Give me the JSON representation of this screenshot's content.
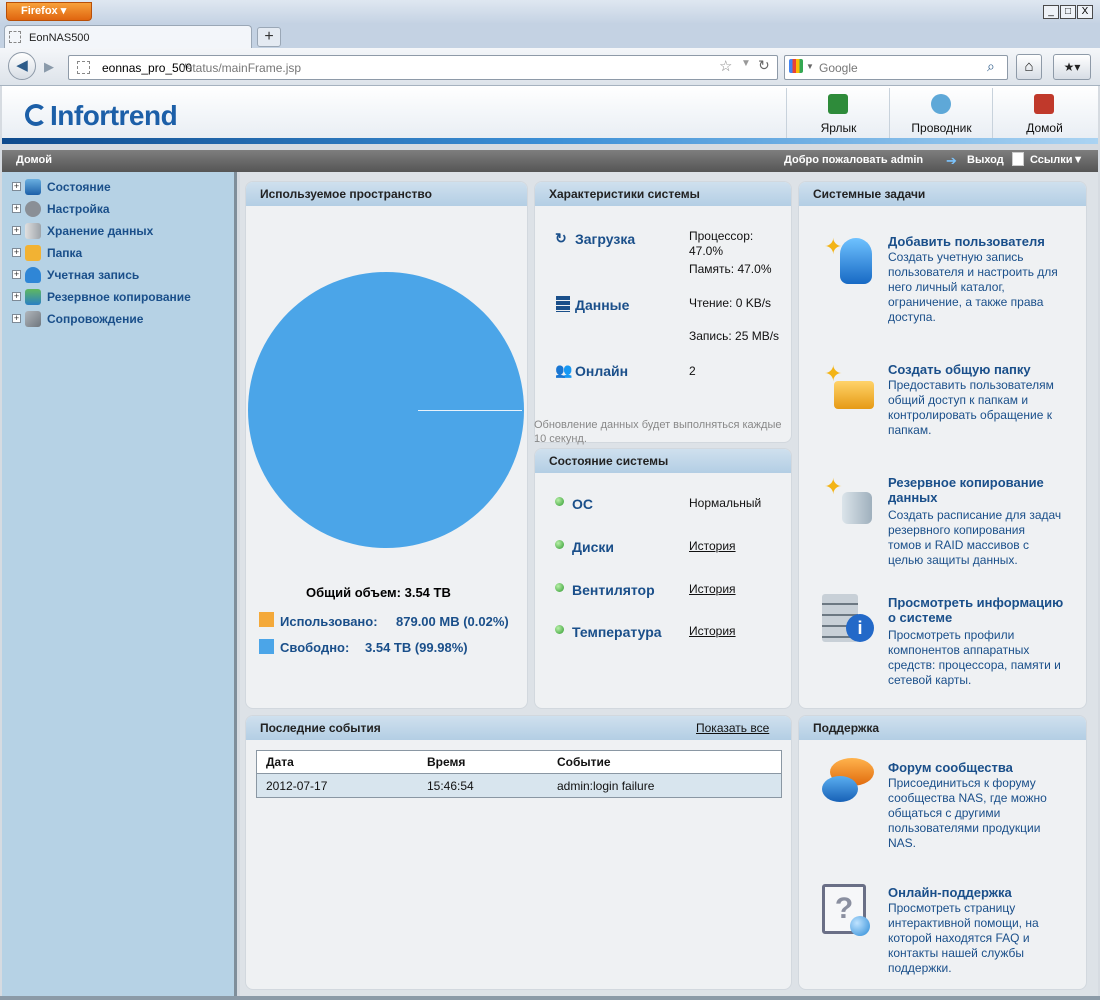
{
  "browser": {
    "firefox_label": "Firefox",
    "tab_title": "EonNAS500",
    "newtab": "+",
    "url_host": "eonnas_pro_500",
    "url_path": "/status/mainFrame.jsp",
    "search_placeholder": "Google",
    "win_min": "_",
    "win_max": "□",
    "win_close": "X"
  },
  "header": {
    "logo": "Infortrend",
    "buttons": [
      {
        "label": "Ярлык",
        "icon": "shortcut-icon",
        "color": "#2e8b3a"
      },
      {
        "label": "Проводник",
        "icon": "explorer-icon",
        "color": "#5ea8d8"
      },
      {
        "label": "Домой",
        "icon": "home-icon",
        "color": "#c0392b"
      }
    ]
  },
  "menubar": {
    "home": "Домой",
    "welcome": "Добро пожаловать admin",
    "logout": "Выход",
    "links": "Ссылки▼"
  },
  "sidebar": {
    "items": [
      {
        "label": "Состояние",
        "icon": "monitor-icon"
      },
      {
        "label": "Настройка",
        "icon": "gear-icon"
      },
      {
        "label": "Хранение данных",
        "icon": "storage-icon"
      },
      {
        "label": "Папка",
        "icon": "folder-icon"
      },
      {
        "label": "Учетная запись",
        "icon": "user-icon"
      },
      {
        "label": "Резервное копирование",
        "icon": "backup-icon"
      },
      {
        "label": "Сопровождение",
        "icon": "tools-icon"
      }
    ]
  },
  "space": {
    "title": "Используемое пространство",
    "total": "Общий объем: 3.54 TB",
    "used_label": "Использовано:",
    "used_value": "879.00 MB (0.02%)",
    "free_label": "Свободно:",
    "free_value": "3.54 TB (99.98%)",
    "used_color": "#f4a93a",
    "free_color": "#4ba5e8"
  },
  "chart_data": {
    "type": "pie",
    "title": "",
    "slices": [
      {
        "name": "Использовано",
        "value": 0.02,
        "color": "#f4a93a"
      },
      {
        "name": "Свободно",
        "value": 99.98,
        "color": "#4ba5e8"
      }
    ]
  },
  "specs": {
    "title": "Характеристики системы",
    "load_label": "Загрузка",
    "cpu_line1": "Процессор:",
    "cpu_line2": "47.0%",
    "mem": "Память: 47.0%",
    "data_label": "Данные",
    "read": "Чтение: 0 KB/s",
    "write": "Запись: 25 MB/s",
    "online_label": "Онлайн",
    "online_value": "2",
    "note": "Обновление данных будет выполняться каждые 10 секунд."
  },
  "status": {
    "title": "Состояние системы",
    "rows": [
      {
        "label": "ОС",
        "value": "Нормальный"
      },
      {
        "label": "Диски",
        "value": "История"
      },
      {
        "label": "Вентилятор",
        "value": "История"
      },
      {
        "label": "Температура",
        "value": "История"
      }
    ]
  },
  "tasks": {
    "title": "Системные задачи",
    "items": [
      {
        "title": "Добавить пользователя",
        "desc": [
          "Создать учетную запись",
          "пользователя и настроить для",
          "него личный каталог,",
          "ограничение, а также права",
          "доступа."
        ]
      },
      {
        "title": "Создать общую папку",
        "desc": [
          "Предоставить пользователям",
          "общий доступ к папкам и",
          "контролировать обращение к",
          "папкам."
        ]
      },
      {
        "title1": "Резервное копирование",
        "title2": "данных",
        "desc": [
          "Создать расписание для задач",
          "резервного копирования",
          "томов и RAID массивов с",
          "целью защиты данных."
        ]
      },
      {
        "title1": "Просмотреть информацию",
        "title2": "о системе",
        "desc": [
          "Просмотреть профили",
          "компонентов аппаратных",
          "средств: процессора, памяти и",
          "сетевой карты."
        ]
      }
    ]
  },
  "events": {
    "title": "Последние события",
    "show_all": "Показать все",
    "columns": [
      "Дата",
      "Время",
      "Событие"
    ],
    "rows": [
      [
        "2012-07-17",
        "15:46:54",
        "admin:login failure"
      ]
    ]
  },
  "support": {
    "title": "Поддержка",
    "items": [
      {
        "title": "Форум сообщества",
        "desc": [
          "Присоединиться к форуму",
          "сообщества NAS, где можно",
          "общаться с другими",
          "пользователями продукции",
          "NAS."
        ]
      },
      {
        "title": "Онлайн-поддержка",
        "desc": [
          "Просмотреть страницу",
          "интерактивной помощи, на",
          "которой находятся FAQ и",
          "контакты нашей службы",
          "поддержки."
        ]
      }
    ]
  }
}
